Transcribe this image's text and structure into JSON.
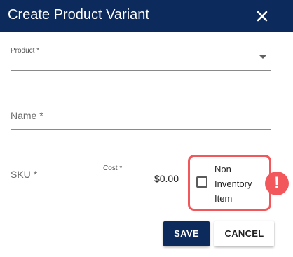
{
  "dialog": {
    "title": "Create Product Variant",
    "close_icon": "close-icon"
  },
  "fields": {
    "product": {
      "label": "Product *",
      "value": ""
    },
    "name": {
      "label": "Name *",
      "value": ""
    },
    "sku": {
      "label": "SKU *",
      "value": ""
    },
    "cost": {
      "label": "Cost *",
      "value": "$0.00"
    }
  },
  "non_inventory": {
    "label_line1": "Non",
    "label_line2": "Inventory",
    "label_line3": "Item",
    "checked": false,
    "alert_icon": "exclamation-icon",
    "alert_glyph": "!"
  },
  "actions": {
    "save_label": "SAVE",
    "cancel_label": "CANCEL"
  },
  "colors": {
    "header_bg": "#0c2a5b",
    "highlight": "#f2585b"
  }
}
